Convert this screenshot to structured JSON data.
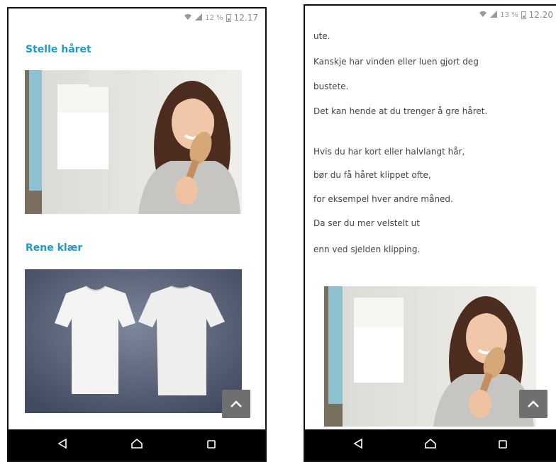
{
  "left_screen": {
    "status": {
      "battery": "12 %",
      "time": "12.17"
    },
    "heading_hair": "Stelle håret",
    "heading_clothes": "Rene klær"
  },
  "right_screen": {
    "status": {
      "battery": "13 %",
      "time": "12.20"
    },
    "paragraph_1": [
      "ute.",
      "Kanskje har vinden eller luen gjort deg",
      "bustete.",
      "Det kan hende at du trenger å gre håret."
    ],
    "paragraph_2": [
      "Hvis du har kort eller halvlangt hår,",
      "bør du få håret klippet ofte,",
      "for eksempel hver andre måned.",
      "Da ser du mer velstelt ut",
      "enn ved sjelden klipping."
    ]
  },
  "colors": {
    "heading": "#1f9bc7",
    "nav_bar": "#000000",
    "scroll_button": "#6f6f6f"
  },
  "icons": [
    "wifi-icon",
    "signal-icon",
    "battery-icon",
    "back-icon",
    "home-icon",
    "recents-icon",
    "chevron-up-icon"
  ]
}
